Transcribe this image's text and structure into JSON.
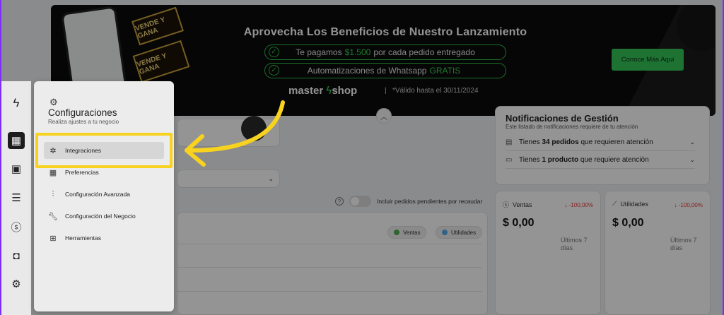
{
  "banner": {
    "headline": "Aprovecha Los Beneficios de Nuestro Lanzamiento",
    "pill1_pre": "Te pagamos",
    "pill1_highlight": "$1.500",
    "pill1_post": "por cada pedido entregado",
    "pill2_pre": "Automatizaciones de Whatsapp",
    "pill2_highlight": "GRATIS",
    "brand": "master shop",
    "validity": "*Válido hasta el 30/11/2024",
    "cta": "Conoce Más Aqui",
    "ticket_text": "VENDE Y GANA",
    "accent": "#34c759"
  },
  "notifications": {
    "title": "Notificaciones de Gestión",
    "subtitle": "Este listado de notificaciones requiere de tu atención",
    "row1_pre": "Tienes",
    "row1_bold": "34 pedidos",
    "row1_post": "que requieren atención",
    "row2_pre": "Tienes",
    "row2_bold": "1 producto",
    "row2_post": "que requiere atención"
  },
  "kpis": [
    {
      "label": "Ventas",
      "change": "-100,00%",
      "value": "$ 0,00",
      "period": "Últimos 7 días"
    },
    {
      "label": "Utilidades",
      "change": "-100,00%",
      "value": "$ 0,00",
      "period": "Últimos 7 días"
    }
  ],
  "filters": {
    "toggle_label": "Incluir pedidos pendientes por recaudar"
  },
  "legend": {
    "ventas": "Ventas",
    "utilidades": "Utilidades",
    "ventas_color": "#4caf50",
    "utilidades_color": "#5aa9e6"
  },
  "settings_panel": {
    "title": "Configuraciones",
    "subtitle": "Realiza ajustes a tu negocio",
    "items": [
      {
        "label": "Integraciones",
        "icon": "integrations-icon"
      },
      {
        "label": "Preferencias",
        "icon": "preferences-icon"
      },
      {
        "label": "Configuración Avanzada",
        "icon": "advanced-config-icon"
      },
      {
        "label": "Configuración del Negocio",
        "icon": "wrench-icon"
      },
      {
        "label": "Herramientas",
        "icon": "tools-icon"
      }
    ],
    "highlight_color": "#f7d21e"
  },
  "sidebar": {
    "icons": [
      "logo-bolt-icon",
      "dashboard-icon",
      "archive-icon",
      "orders-icon",
      "dollar-icon",
      "wallet-icon",
      "gear-icon"
    ]
  }
}
